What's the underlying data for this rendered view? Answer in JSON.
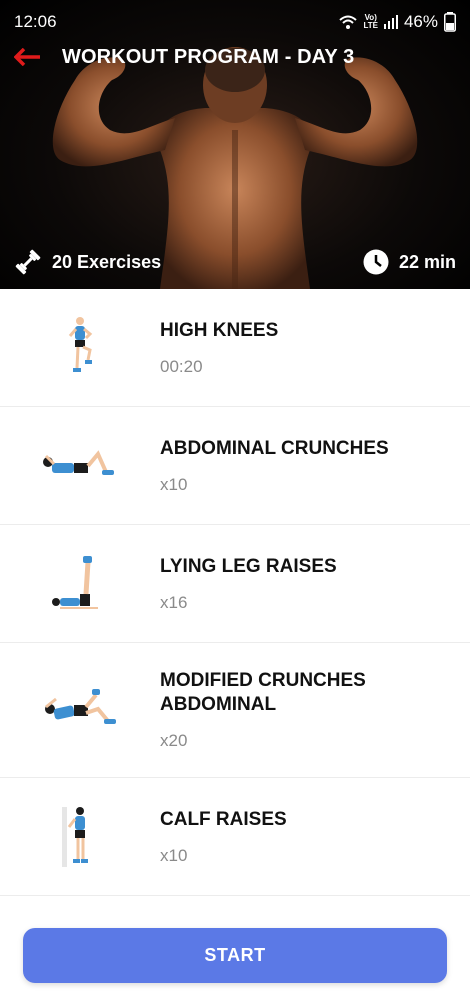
{
  "status_bar": {
    "time": "12:06",
    "battery": "46%",
    "network_top": "Vo)",
    "network_bottom": "LTE"
  },
  "header": {
    "title": "WORKOUT PROGRAM - DAY 3"
  },
  "hero": {
    "exercises_count": "20 Exercises",
    "duration": "22 min"
  },
  "exercises": [
    {
      "name_line1": "HIGH KNEES",
      "name_line2": "",
      "meta": "00:20"
    },
    {
      "name_line1": "ABDOMINAL CRUNCHES",
      "name_line2": "",
      "meta": "x10"
    },
    {
      "name_line1": "LYING LEG RAISES",
      "name_line2": "",
      "meta": "x16"
    },
    {
      "name_line1": "MODIFIED CRUNCHES",
      "name_line2": "ABDOMINAL",
      "meta": "x20"
    },
    {
      "name_line1": "CALF RAISES",
      "name_line2": "",
      "meta": "x10"
    }
  ],
  "start_button": {
    "label": "START"
  },
  "colors": {
    "accent": "#5b79e6",
    "back_arrow": "#e01b1b",
    "shirt": "#3d8fd1",
    "shorts": "#1c1c1c",
    "skin": "#f1c49f"
  }
}
